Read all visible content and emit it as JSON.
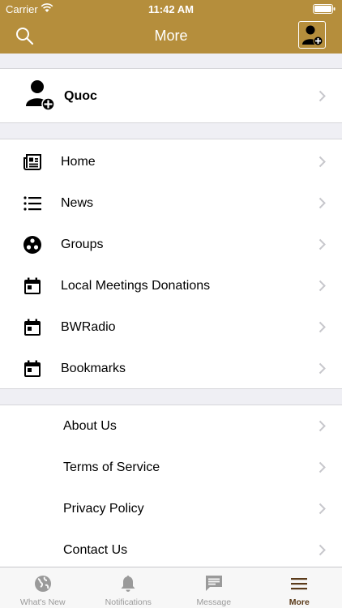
{
  "status_bar": {
    "carrier": "Carrier",
    "time": "11:42 AM"
  },
  "nav": {
    "title": "More",
    "search_icon": "search-icon",
    "profile_icon": "add-user-icon"
  },
  "profile": {
    "name": "Quoc",
    "icon": "add-user-icon"
  },
  "menu": [
    {
      "label": "Home",
      "icon": "newspaper-icon"
    },
    {
      "label": "News",
      "icon": "list-icon"
    },
    {
      "label": "Groups",
      "icon": "groups-icon"
    },
    {
      "label": "Local Meetings Donations",
      "icon": "calendar-icon"
    },
    {
      "label": "BWRadio",
      "icon": "calendar-icon"
    },
    {
      "label": "Bookmarks",
      "icon": "calendar-icon"
    }
  ],
  "info_links": [
    {
      "label": "About Us"
    },
    {
      "label": "Terms of Service"
    },
    {
      "label": "Privacy Policy"
    },
    {
      "label": "Contact Us"
    }
  ],
  "tabs": [
    {
      "label": "What's New",
      "icon": "globe-icon",
      "active": false
    },
    {
      "label": "Notifications",
      "icon": "bell-icon",
      "active": false
    },
    {
      "label": "Message",
      "icon": "chat-icon",
      "active": false
    },
    {
      "label": "More",
      "icon": "menu-icon",
      "active": true
    }
  ],
  "colors": {
    "header": "#b58e3c",
    "active_tab": "#5b3b1a",
    "inactive_tab": "#9a9a9a"
  }
}
